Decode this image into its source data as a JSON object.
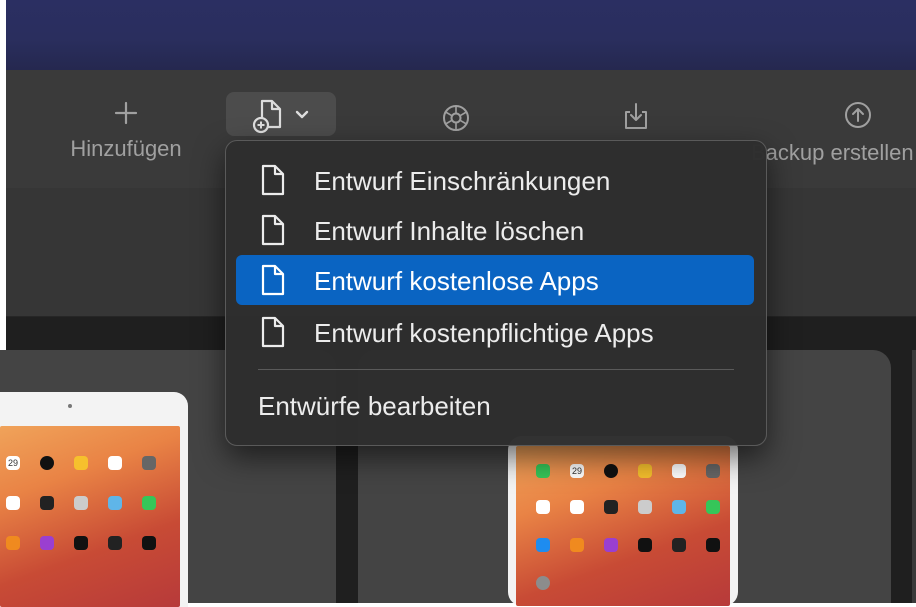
{
  "toolbar": {
    "add_label": "Hinzufügen",
    "backup_label": "Backup erstellen"
  },
  "menu": {
    "items": [
      {
        "label": "Entwurf Einschränkungen",
        "icon": "document-icon",
        "selected": false
      },
      {
        "label": "Entwurf Inhalte löschen",
        "icon": "document-icon",
        "selected": false
      },
      {
        "label": "Entwurf kostenlose Apps",
        "icon": "document-icon",
        "selected": true
      },
      {
        "label": "Entwurf kostenpflichtige Apps",
        "icon": "document-icon",
        "selected": false
      }
    ],
    "edit_label": "Entwürfe bearbeiten"
  },
  "devices": {
    "left_date": "29",
    "right_date": "29"
  },
  "colors": {
    "titlebar": "#2a2e5e",
    "toolbar": "#3a3a3a",
    "menu_background": "#2e2e2e",
    "menu_selected": "#0a64c2",
    "content_background": "#1f1f1f"
  }
}
